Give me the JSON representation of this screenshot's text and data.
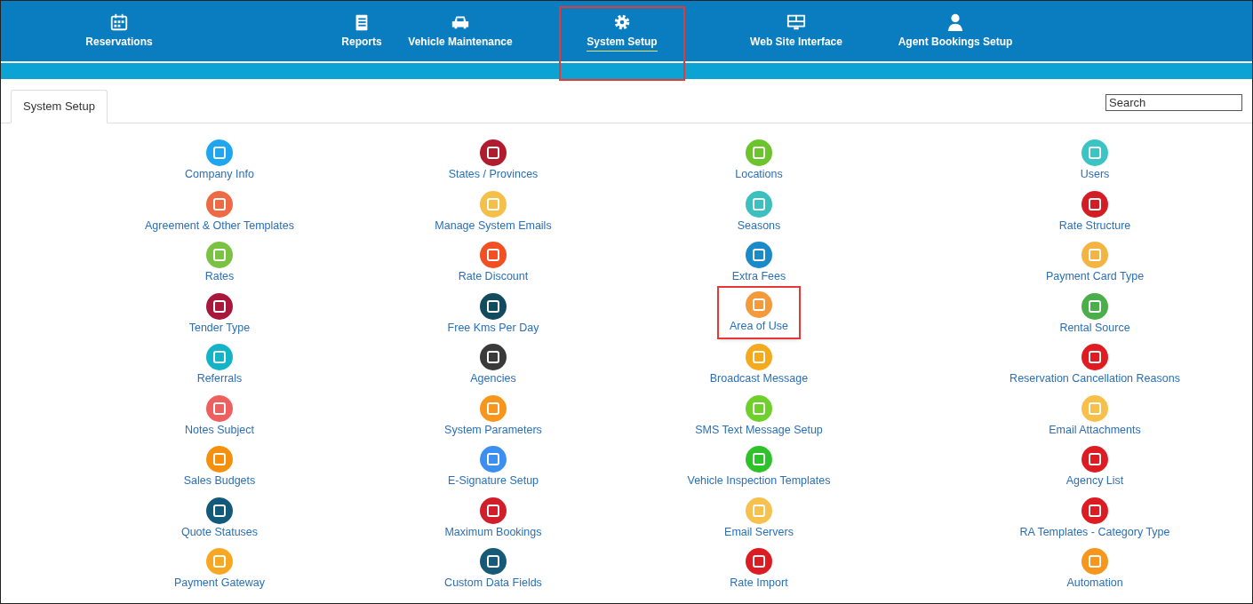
{
  "nav": [
    {
      "label": "Reservations",
      "selected": false,
      "highlighted": false
    },
    {
      "label": "Reports",
      "selected": false,
      "highlighted": false
    },
    {
      "label": "Vehicle Maintenance",
      "selected": false,
      "highlighted": false
    },
    {
      "label": "System Setup",
      "selected": true,
      "highlighted": true
    },
    {
      "label": "Web Site Interface",
      "selected": false,
      "highlighted": false
    },
    {
      "label": "Agent Bookings Setup",
      "selected": false,
      "highlighted": false
    }
  ],
  "tabs": [
    {
      "label": "System Setup",
      "selected": true
    }
  ],
  "search": {
    "placeholder": "Search"
  },
  "columns": [
    [
      {
        "label": "Company Info",
        "color": "#1ea7f0",
        "highlighted": false
      },
      {
        "label": "Agreement & Other Templates",
        "color": "#ee6a44",
        "highlighted": false
      },
      {
        "label": "Rates",
        "color": "#7cc242",
        "highlighted": false
      },
      {
        "label": "Tender Type",
        "color": "#a8183a",
        "highlighted": false
      },
      {
        "label": "Referrals",
        "color": "#14b4c8",
        "highlighted": false
      },
      {
        "label": "Notes Subject",
        "color": "#ee5f5f",
        "highlighted": false
      },
      {
        "label": "Sales Budgets",
        "color": "#f5900f",
        "highlighted": false
      },
      {
        "label": "Quote Statuses",
        "color": "#125a7a",
        "highlighted": false
      },
      {
        "label": "Payment Gateway",
        "color": "#f7a823",
        "highlighted": false
      }
    ],
    [
      {
        "label": "States / Provinces",
        "color": "#b01c2e",
        "highlighted": false
      },
      {
        "label": "Manage System Emails",
        "color": "#f4c04a",
        "highlighted": false
      },
      {
        "label": "Rate Discount",
        "color": "#f05022",
        "highlighted": false
      },
      {
        "label": "Free Kms Per Day",
        "color": "#124a5e",
        "highlighted": false
      },
      {
        "label": "Agencies",
        "color": "#3a3a3a",
        "highlighted": false
      },
      {
        "label": "System Parameters",
        "color": "#f7961c",
        "highlighted": false
      },
      {
        "label": "E-Signature Setup",
        "color": "#3a8ff0",
        "highlighted": false
      },
      {
        "label": "Maximum Bookings",
        "color": "#d01f2a",
        "highlighted": false
      },
      {
        "label": "Custom Data Fields",
        "color": "#165a78",
        "highlighted": false
      }
    ],
    [
      {
        "label": "Locations",
        "color": "#6cc42c",
        "highlighted": false
      },
      {
        "label": "Seasons",
        "color": "#3bbfbf",
        "highlighted": false
      },
      {
        "label": "Extra Fees",
        "color": "#1a8ac8",
        "highlighted": false
      },
      {
        "label": "Area of Use",
        "color": "#f29a3c",
        "highlighted": true
      },
      {
        "label": "Broadcast Message",
        "color": "#f5aa1e",
        "highlighted": false
      },
      {
        "label": "SMS Text Message Setup",
        "color": "#6ed02a",
        "highlighted": false
      },
      {
        "label": "Vehicle Inspection Templates",
        "color": "#2ec22a",
        "highlighted": false
      },
      {
        "label": "Email Servers",
        "color": "#f6c14c",
        "highlighted": false
      },
      {
        "label": "Rate Import",
        "color": "#dc1c22",
        "highlighted": false
      }
    ],
    [
      {
        "label": "Users",
        "color": "#3cc4c4",
        "highlighted": false
      },
      {
        "label": "Rate Structure",
        "color": "#d41c24",
        "highlighted": false
      },
      {
        "label": "Payment Card Type",
        "color": "#f3b444",
        "highlighted": false
      },
      {
        "label": "Rental Source",
        "color": "#4aae4a",
        "highlighted": false
      },
      {
        "label": "Reservation Cancellation Reasons",
        "color": "#e01c22",
        "highlighted": false
      },
      {
        "label": "Email Attachments",
        "color": "#f6c04a",
        "highlighted": false
      },
      {
        "label": "Agency List",
        "color": "#dc1c22",
        "highlighted": false
      },
      {
        "label": "RA Templates - Category Type",
        "color": "#dc1c22",
        "highlighted": false
      },
      {
        "label": "Automation",
        "color": "#f7961c",
        "highlighted": false
      }
    ]
  ]
}
